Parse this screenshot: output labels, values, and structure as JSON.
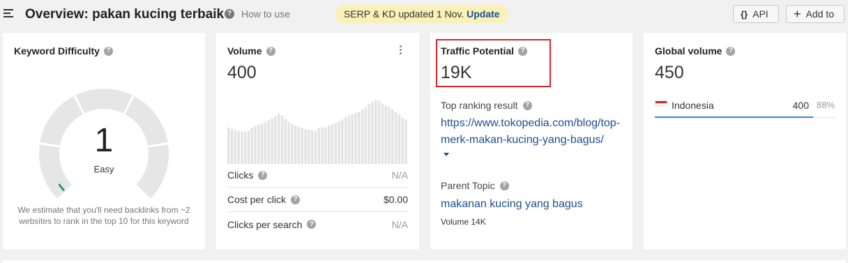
{
  "header": {
    "title": "Overview: pakan kucing terbaik",
    "help_glyph": "?",
    "how_to_use": "How to use",
    "update_banner_text": "SERP & KD updated 1 Nov.",
    "update_link": "Update",
    "api_glyph": "{}",
    "api_label": "API",
    "add_glyph": "+",
    "add_label": "Add to"
  },
  "keyword_difficulty": {
    "label": "Keyword Difficulty",
    "value": "1",
    "rating": "Easy",
    "description": "We estimate that you'll need backlinks from ~2 websites to rank in the top 10 for this keyword",
    "gauge_segments": 5,
    "gauge_fill_color": "#1f9d5b",
    "gauge_track_color": "#e6e6e6"
  },
  "volume": {
    "label": "Volume",
    "value": "400",
    "history_relative": [
      0.55,
      0.53,
      0.51,
      0.5,
      0.49,
      0.48,
      0.5,
      0.55,
      0.57,
      0.59,
      0.61,
      0.63,
      0.66,
      0.69,
      0.72,
      0.76,
      0.73,
      0.68,
      0.64,
      0.61,
      0.58,
      0.56,
      0.54,
      0.53,
      0.52,
      0.51,
      0.5,
      0.54,
      0.55,
      0.55,
      0.58,
      0.6,
      0.62,
      0.64,
      0.67,
      0.7,
      0.73,
      0.75,
      0.77,
      0.79,
      0.82,
      0.85,
      0.9,
      0.94,
      0.96,
      0.95,
      0.91,
      0.88,
      0.86,
      0.82,
      0.78,
      0.75,
      0.7,
      0.67
    ],
    "bar_color": "#e3e3e3",
    "metrics": [
      {
        "label": "Clicks",
        "value": "N/A"
      },
      {
        "label": "Cost per click",
        "value": "$0.00"
      },
      {
        "label": "Clicks per search",
        "value": "N/A"
      }
    ]
  },
  "traffic_potential": {
    "label": "Traffic Potential",
    "value": "19K",
    "top_ranking_label": "Top ranking result",
    "top_ranking_url": "https://www.tokopedia.com/blog/top-merk-makan-kucing-yang-bagus/",
    "parent_topic_label": "Parent Topic",
    "parent_topic": "makanan kucing yang bagus",
    "parent_volume": "Volume 14K",
    "highlight_color": "#d9242b"
  },
  "global_volume": {
    "label": "Global volume",
    "value": "450",
    "countries": [
      {
        "name": "Indonesia",
        "value": "400",
        "percent": "88%",
        "share": 0.88
      }
    ]
  }
}
